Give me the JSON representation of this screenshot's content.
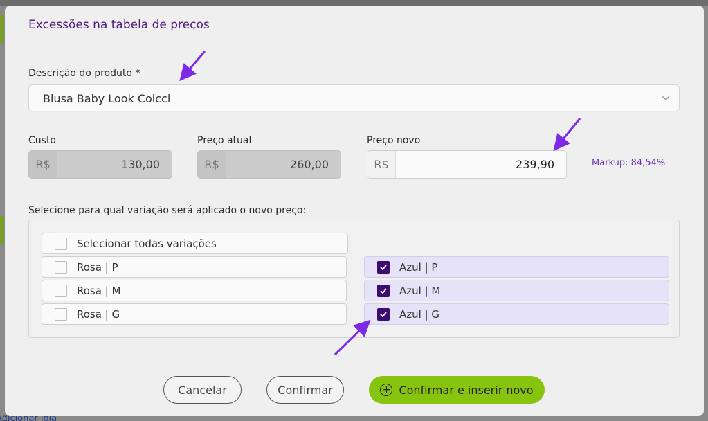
{
  "background": {
    "link_text": "Adicionar loja"
  },
  "modal": {
    "title": "Excessões na tabela de preços",
    "product": {
      "label": "Descrição do produto *",
      "value": "Blusa Baby Look Colcci",
      "icon": "chevron-down-icon"
    },
    "cost": {
      "label": "Custo",
      "currency": "R$",
      "value": "130,00"
    },
    "current_price": {
      "label": "Preço atual",
      "currency": "R$",
      "value": "260,00"
    },
    "new_price": {
      "label": "Preço novo",
      "currency": "R$",
      "value": "239,90"
    },
    "markup": "Markup: 84,54%",
    "variations": {
      "label": "Selecione para qual variação será aplicado o novo preço:",
      "select_all": {
        "label": "Selecionar todas variações",
        "checked": false
      },
      "items": [
        {
          "label": "Rosa | P",
          "checked": false
        },
        {
          "label": "Rosa | M",
          "checked": false
        },
        {
          "label": "Rosa | G",
          "checked": false
        },
        {
          "label": "Azul | P",
          "checked": true
        },
        {
          "label": "Azul | M",
          "checked": true
        },
        {
          "label": "Azul | G",
          "checked": true
        }
      ]
    },
    "buttons": {
      "cancel": "Cancelar",
      "confirm": "Confirmar",
      "confirm_and_new": "Confirmar e inserir novo",
      "confirm_and_new_icon": "plus-circle-icon"
    }
  },
  "colors": {
    "title": "#4b1a7a",
    "accent_arrow": "#7c2ae8",
    "checked_box": "#3c0d6e",
    "checked_row": "#e6e2f8",
    "primary_button": "#86c40f",
    "markup": "#6b2fb3"
  }
}
